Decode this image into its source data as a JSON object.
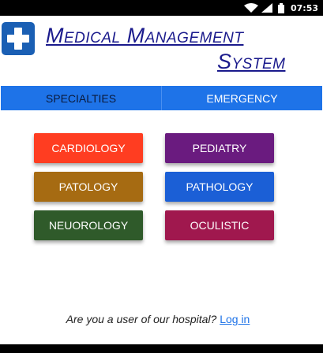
{
  "status_bar": {
    "time": "07:53",
    "icons": [
      "wifi-icon",
      "signal-icon",
      "battery-icon"
    ]
  },
  "header": {
    "logo_icon": "medical-cross-icon",
    "title_line1": "Medical Management",
    "title_line2": "System"
  },
  "tabs": [
    {
      "label": "SPECIALTIES"
    },
    {
      "label": "EMERGENCY"
    }
  ],
  "specialties": [
    {
      "label": "CARDIOLOGY",
      "color": "#ff3d21"
    },
    {
      "label": "PEDIATRY",
      "color": "#6a1b7f"
    },
    {
      "label": "PATOLOGY",
      "color": "#a66b12"
    },
    {
      "label": "PATHOLOGY",
      "color": "#1b5fd6"
    },
    {
      "label": "NEUOROLOGY",
      "color": "#2f5a2a"
    },
    {
      "label": "OCULISTIC",
      "color": "#a0184e"
    }
  ],
  "footer": {
    "prompt": "Are you a user of our hospital?",
    "login_label": "Log in"
  },
  "colors": {
    "accent": "#1e73e8",
    "title": "#1a1a8c",
    "logo": "#1a5fb4"
  }
}
